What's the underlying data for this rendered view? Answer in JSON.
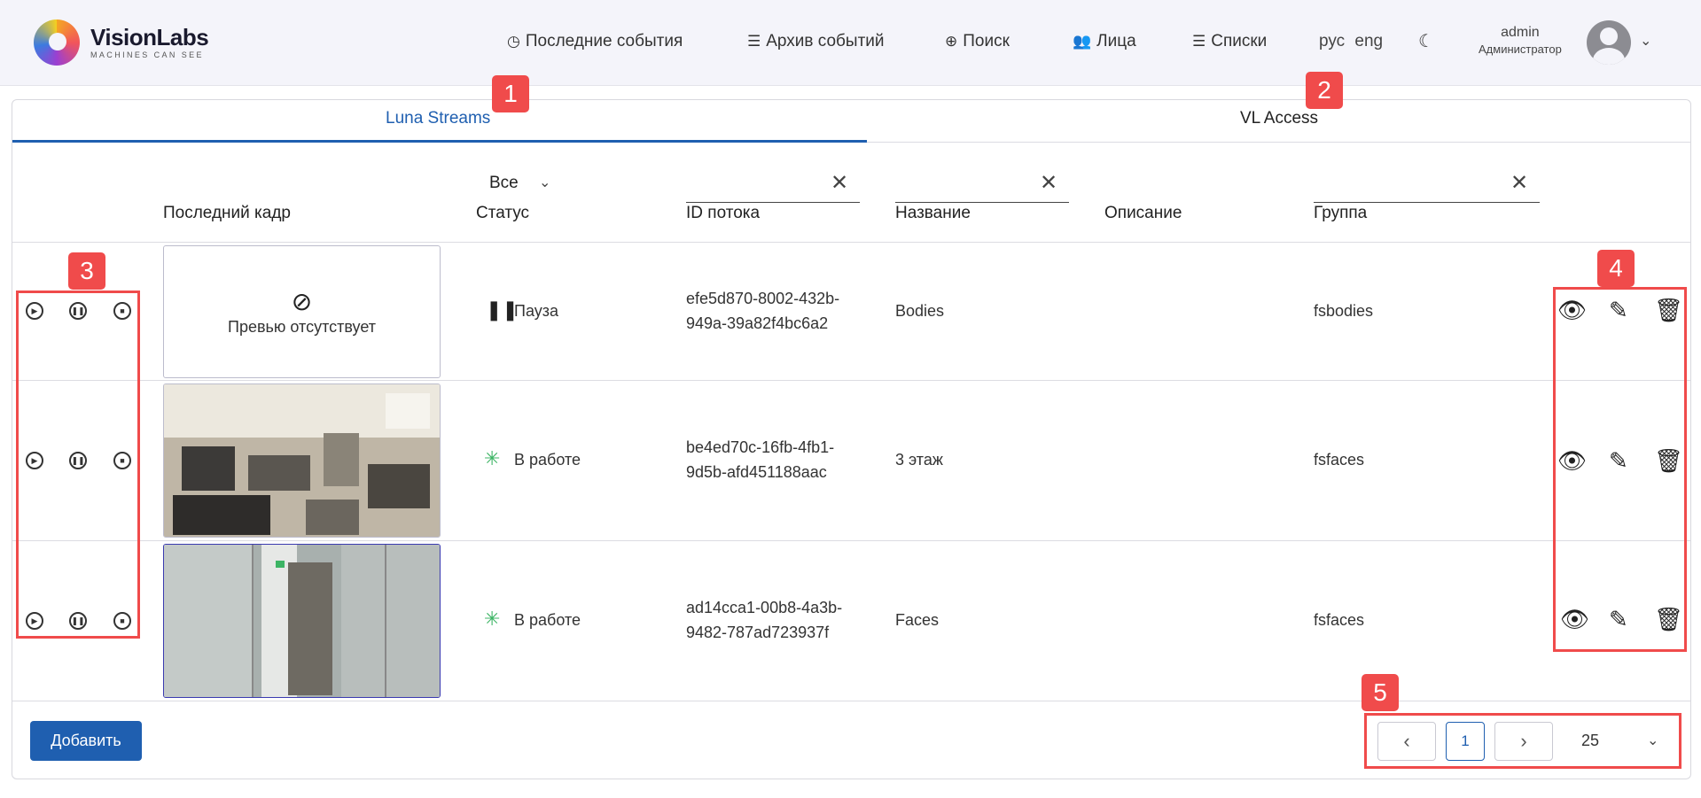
{
  "header": {
    "logo_name": "VisionLabs",
    "logo_tagline": "MACHINES CAN SEE",
    "nav": [
      {
        "label": "Последние события",
        "icon": "clock-icon"
      },
      {
        "label": "Архив событий",
        "icon": "list-icon"
      },
      {
        "label": "Поиск",
        "icon": "crosshair-icon"
      },
      {
        "label": "Лица",
        "icon": "users-icon"
      },
      {
        "label": "Списки",
        "icon": "list-icon"
      }
    ],
    "lang_ru": "рус",
    "lang_en": "eng",
    "user_name": "admin",
    "user_role": "Администратор"
  },
  "tabs": [
    {
      "label": "Luna Streams"
    },
    {
      "label": "VL Access"
    }
  ],
  "filters": {
    "status_value": "Все"
  },
  "columns": {
    "last_frame": "Последний кадр",
    "status": "Статус",
    "stream_id": "ID потока",
    "name": "Название",
    "description": "Описание",
    "group": "Группа"
  },
  "rows": [
    {
      "preview": "none",
      "preview_text": "Превью отсутствует",
      "status": "Пауза",
      "id_line1": "efe5d870-8002-432b-",
      "id_line2": "949a-39a82f4bc6a2",
      "name": "Bodies",
      "description": "",
      "group": "fsbodies"
    },
    {
      "preview": "office-camera",
      "status": "В работе",
      "id_line1": "be4ed70c-16fb-4fb1-",
      "id_line2": "9d5b-afd451188aac",
      "name": "3 этаж",
      "description": "",
      "group": "fsfaces"
    },
    {
      "preview": "corridor-camera",
      "status": "В работе",
      "id_line1": "ad14cca1-00b8-4a3b-",
      "id_line2": "9482-787ad723937f",
      "name": "Faces",
      "description": "",
      "group": "fsfaces"
    }
  ],
  "footer": {
    "add_label": "Добавить",
    "page_current": "1",
    "page_size": "25"
  },
  "annotations": [
    "1",
    "2",
    "3",
    "4",
    "5"
  ],
  "colors": {
    "accent": "#1f5fb0",
    "annotation": "#f04b4b",
    "running": "#3cb464"
  }
}
